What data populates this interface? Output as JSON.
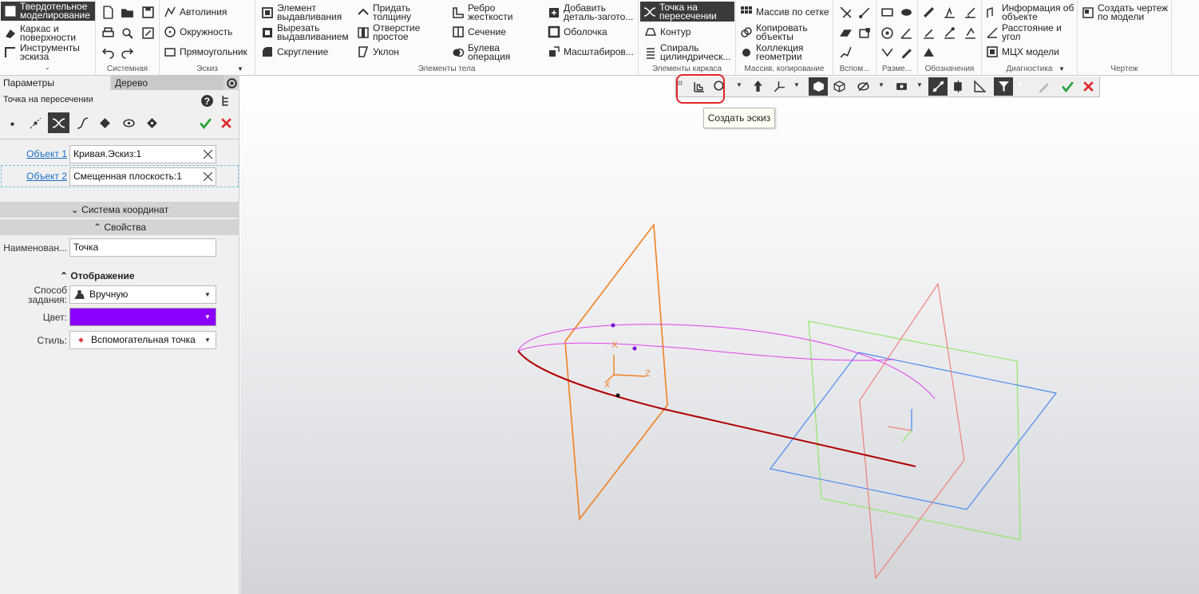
{
  "ribbon": {
    "mode_items": [
      "Твердотельное моделирование",
      "Каркас и поверхности",
      "Инструменты эскиза"
    ],
    "groups": {
      "system": "Системная",
      "sketch": "Эскиз",
      "body_elements": "Элементы тела",
      "frame_elements": "Элементы каркаса",
      "array": "Массив, копирование",
      "aux": "Вспом...",
      "dims": "Разме...",
      "designations": "Обозначения",
      "diagnostics": "Диагностика",
      "drawing": "Чертеж"
    },
    "sketch": {
      "autoline": "Автолиния",
      "circle": "Окружность",
      "rectangle": "Прямоугольник"
    },
    "body": {
      "extrude": "Элемент выдавливания",
      "cut_extrude": "Вырезать выдавливанием",
      "fillet": "Скругление",
      "thicken": "Придать толщину",
      "hole": "Отверстие простое",
      "draft": "Уклон",
      "rib": "Ребро жесткости",
      "section": "Сечение",
      "boolean": "Булева операция",
      "add_part": "Добавить деталь-загото...",
      "shell": "Оболочка",
      "scale": "Масштабиров..."
    },
    "frame": {
      "intersection_point": "Точка на пересечении",
      "contour": "Контур",
      "cyl_spiral": "Спираль цилиндрическ..."
    },
    "array": {
      "grid_array": "Массив по сетке",
      "copy_objects": "Копировать объекты",
      "geometry_collection": "Коллекция геометрии"
    },
    "diag": {
      "object_info": "Информация об объекте",
      "distance_angle": "Расстояние и угол",
      "mcx": "МЦХ модели"
    },
    "drawing": {
      "create_drawing": "Создать чертеж по модели"
    }
  },
  "panel": {
    "tabs": [
      "Параметры",
      "Дерево"
    ],
    "title": "Точка на пересечении",
    "object1_label": "Объект 1",
    "object1_value": "Кривая.Эскиз:1",
    "object2_label": "Объект 2",
    "object2_value": "Смещенная плоскость:1",
    "coord_section": "Система координат",
    "props_section": "Свойства",
    "name_label": "Наименован...",
    "name_value": "Точка",
    "display_section": "Отображение",
    "method_label": "Способ задания:",
    "method_value": "Вручную",
    "color_label": "Цвет:",
    "color_value": "#8b00ff",
    "style_label": "Стиль:",
    "style_value": "Вспомогательная точка"
  },
  "viewport": {
    "tooltip": "Создать эскиз",
    "axis_x": "X",
    "axis_z": "Z",
    "axis_x2": "X"
  }
}
